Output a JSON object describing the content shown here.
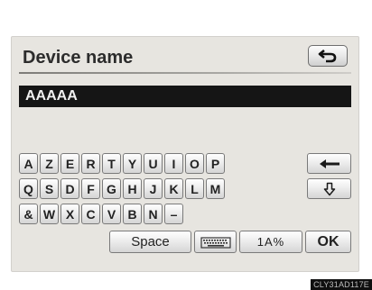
{
  "header": {
    "title": "Device name"
  },
  "input": {
    "value": "AAAAA"
  },
  "keyboard": {
    "row1": [
      "A",
      "Z",
      "E",
      "R",
      "T",
      "Y",
      "U",
      "I",
      "O",
      "P"
    ],
    "row2": [
      "Q",
      "S",
      "D",
      "F",
      "G",
      "H",
      "J",
      "K",
      "L",
      "M"
    ],
    "row3": [
      "&",
      "W",
      "X",
      "C",
      "V",
      "B",
      "N",
      "–"
    ],
    "space_label": "Space",
    "mode_label": "1A%",
    "ok_label": "OK"
  },
  "icons": {
    "back": "return-arrow-icon",
    "backspace": "left-arrow-icon",
    "shift": "down-arrow-icon",
    "keyboard_layout": "keyboard-icon"
  },
  "caption": "CLY31AD117E",
  "colors": {
    "background": "#e7e5e0",
    "input_background": "#151515",
    "key_face": "#e6e6e6"
  }
}
